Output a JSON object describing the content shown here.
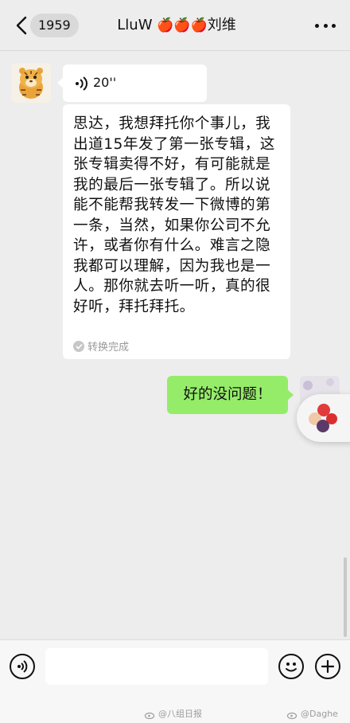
{
  "header": {
    "back_icon": "chevron-left-icon",
    "unread_count": "1959",
    "title_prefix": "LluW",
    "title_apples": "🍎🍎🍎",
    "title_suffix": "刘维",
    "more_icon": "more-horizontal-icon"
  },
  "messages": {
    "voice": {
      "duration": "20''",
      "icon": "voice-wave-icon"
    },
    "transcript": {
      "text": "思达，我想拜托你个事儿，我出道15年发了第一张专辑，这张专辑卖得不好，有可能就是我的最后一张专辑了。所以说能不能帮我转发一下微博的第一条，当然，如果你公司不允许，或者你有什么。难言之隐我都可以理解，因为我也是一人。那你就去听一听，真的很好听，拜托拜托。",
      "status": "转换完成"
    },
    "reply": {
      "text": "好的没问题！"
    }
  },
  "input_bar": {
    "voice_icon": "voice-input-icon",
    "input_value": "",
    "emoji_icon": "emoji-icon",
    "plus_icon": "plus-icon"
  },
  "watermarks": {
    "left": "@八组日报",
    "right": "@Daghe"
  },
  "colors": {
    "background": "#ededed",
    "sent_bubble": "#95ec69",
    "received_bubble": "#ffffff",
    "apple_red": "#d8242b"
  }
}
